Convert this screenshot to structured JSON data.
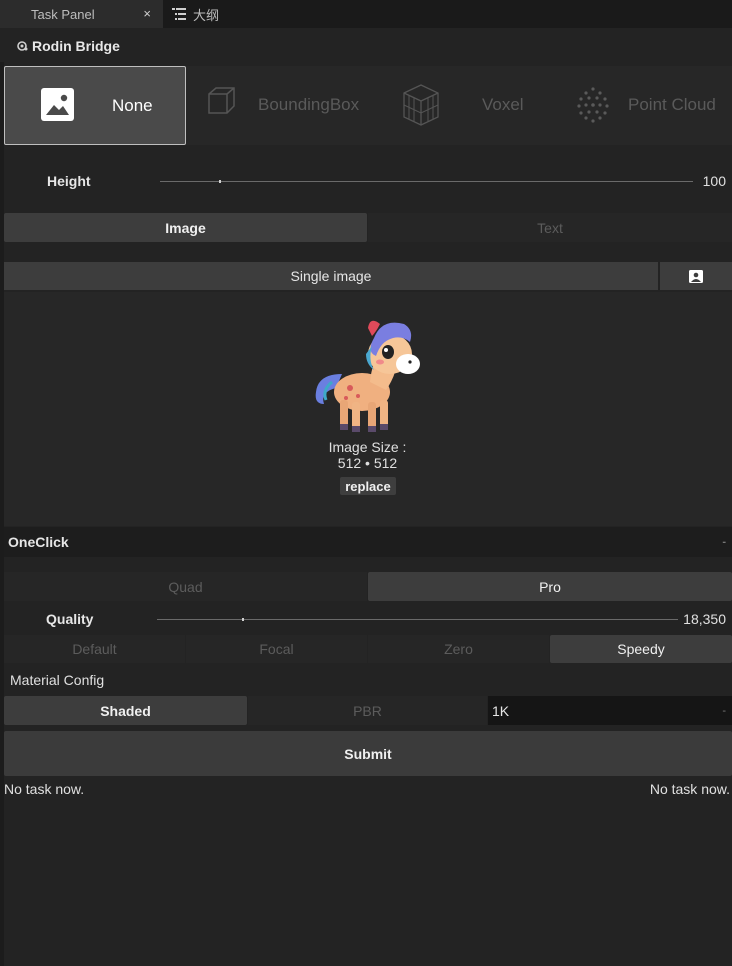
{
  "tabs": [
    {
      "label": "Task Panel",
      "close": "×"
    },
    {
      "label": "大纲",
      "icon": "outline-list-icon"
    }
  ],
  "panel": {
    "title": "Rodin Bridge",
    "icon": "rodin-logo-icon"
  },
  "modes": [
    {
      "label": "None",
      "icon": "image-icon",
      "active": true
    },
    {
      "label": "BoundingBox",
      "icon": "cube-icon",
      "active": false
    },
    {
      "label": "Voxel",
      "icon": "voxel-icon",
      "active": false
    },
    {
      "label": "Point Cloud",
      "icon": "point-cloud-icon",
      "active": false
    }
  ],
  "height": {
    "label": "Height",
    "value": "100",
    "level": 0.11
  },
  "input_type": {
    "image": "Image",
    "text": "Text",
    "selected": "Image"
  },
  "single_image": {
    "label": "Single image",
    "icon": "image-select-icon"
  },
  "image_info": {
    "size_label": "Image Size :",
    "size_value": "512 • 512",
    "replace": "replace"
  },
  "oneclick": {
    "label": "OneClick",
    "collapse": "-"
  },
  "mesh_mode": {
    "quad": "Quad",
    "pro": "Pro",
    "selected": "Pro"
  },
  "quality": {
    "label": "Quality",
    "value": "18,350",
    "level": 0.165
  },
  "quality_presets": {
    "items": [
      "Default",
      "Focal",
      "Zero",
      "Speedy"
    ],
    "selected": "Speedy"
  },
  "material": {
    "label": "Material Config",
    "shaded": "Shaded",
    "pbr": "PBR",
    "selected": "Shaded",
    "resolution": "1K",
    "resolution_dash": "-"
  },
  "submit": "Submit",
  "status": {
    "left": "No task now.",
    "right": "No task now."
  },
  "colors": {
    "background": "#232323",
    "button_on": "#3d3d3d",
    "accent_border": "#bfbfbf"
  }
}
